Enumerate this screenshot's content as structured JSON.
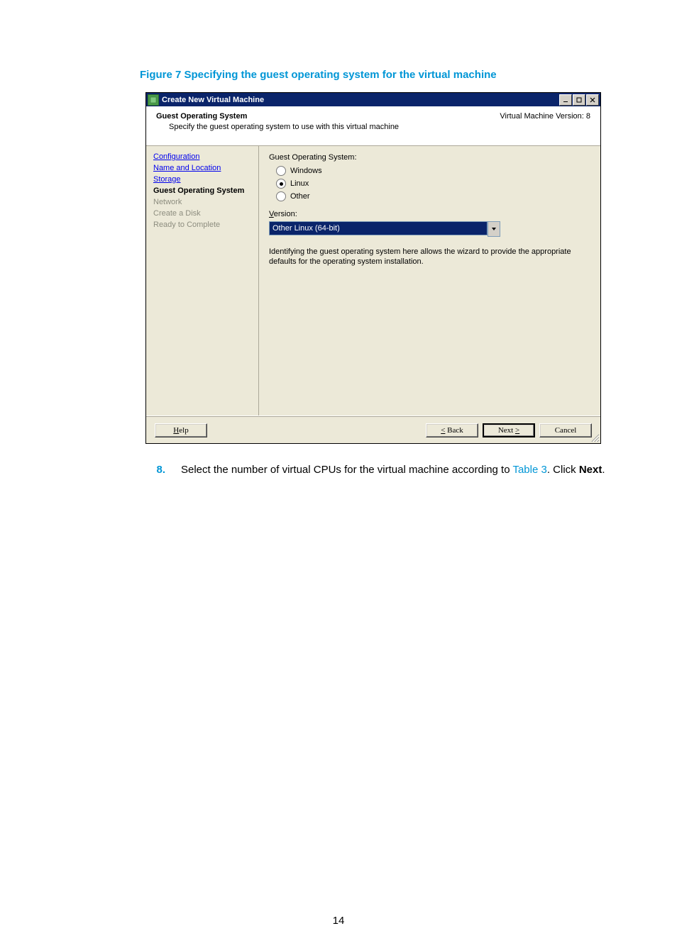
{
  "caption": "Figure 7 Specifying the guest operating system for the virtual machine",
  "dialog": {
    "title": "Create New Virtual Machine",
    "header": {
      "title": "Guest Operating System",
      "subtitle": "Specify the guest operating system to use with this virtual machine",
      "vmversion": "Virtual Machine Version: 8"
    },
    "sidebar": {
      "items": [
        {
          "label": "Configuration",
          "state": "link"
        },
        {
          "label": "Name and Location",
          "state": "link"
        },
        {
          "label": "Storage",
          "state": "link"
        },
        {
          "label": "Guest Operating System",
          "state": "active"
        },
        {
          "label": "Network",
          "state": "disabled"
        },
        {
          "label": "Create a Disk",
          "state": "disabled"
        },
        {
          "label": "Ready to Complete",
          "state": "disabled"
        }
      ]
    },
    "content": {
      "group_label": "Guest Operating System:",
      "radios": [
        {
          "label": "Windows",
          "selected": false
        },
        {
          "label": "Linux",
          "selected": true
        },
        {
          "label": "Other",
          "selected": false
        }
      ],
      "version_label_pre": "V",
      "version_label_rest": "ersion:",
      "version_value": "Other Linux (64-bit)",
      "help_text": "Identifying the guest operating system here allows the wizard to provide the appropriate defaults for the operating system installation."
    },
    "footer": {
      "help": "Help",
      "back": "< Back",
      "next": "Next >",
      "cancel": "Cancel"
    }
  },
  "instruction": {
    "num": "8.",
    "pre": "Select the number of virtual CPUs for the virtual machine according to ",
    "link": "Table 3",
    "post1": ". Click ",
    "bold": "Next",
    "post2": "."
  },
  "pagenum": "14"
}
